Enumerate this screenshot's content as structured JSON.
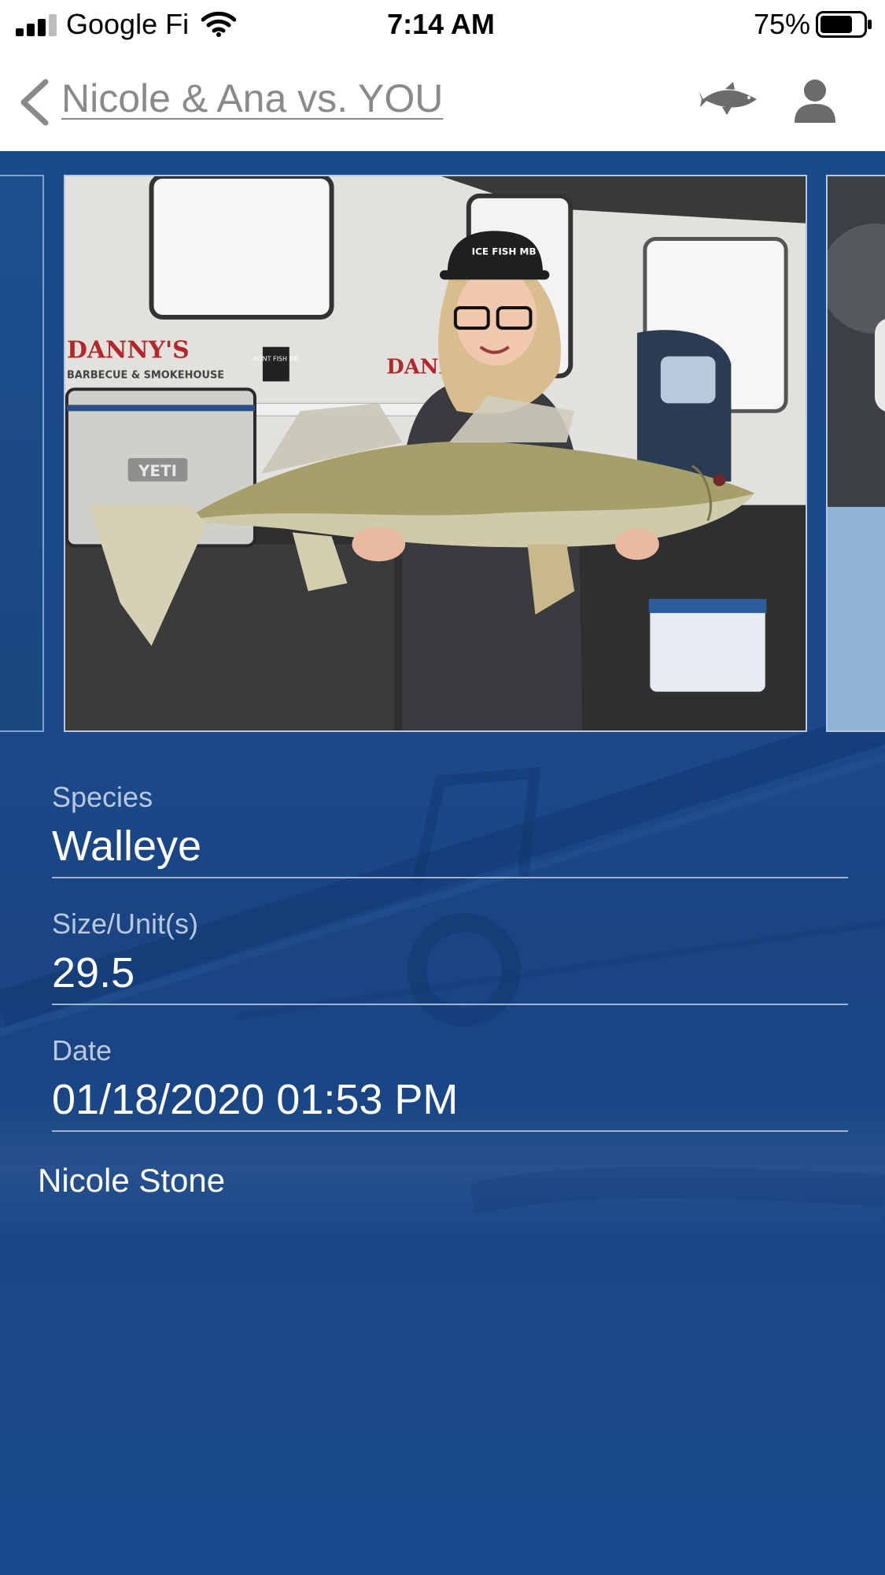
{
  "status_bar": {
    "carrier": "Google Fi",
    "time": "7:14 AM",
    "battery": "75%",
    "signal_bars": 3,
    "battery_level": 0.75
  },
  "nav": {
    "title": "Nicole & Ana vs. YOU",
    "back_icon": "chevron-left-icon",
    "fish_icon": "fish-icon",
    "profile_icon": "person-icon"
  },
  "catch": {
    "species_label": "Species",
    "species": "Walleye",
    "size_label": "Size/Unit(s)",
    "size": "29.5",
    "date_label": "Date",
    "date": "01/18/2020 01:53 PM",
    "angler": "Nicole Stone"
  },
  "photo": {
    "cooler_brand": "YETI",
    "banner_text": "DANNY'S",
    "banner_sub": "BARBECUE & SMOKEHOUSE",
    "cap_text": "ICE FISH MB",
    "sticker_text": "HUNT FISH MB"
  },
  "colors": {
    "background": "#1a4888",
    "divider": "#9fb4d0",
    "label": "#b9c8de",
    "nav_title": "#8a8a8a"
  }
}
